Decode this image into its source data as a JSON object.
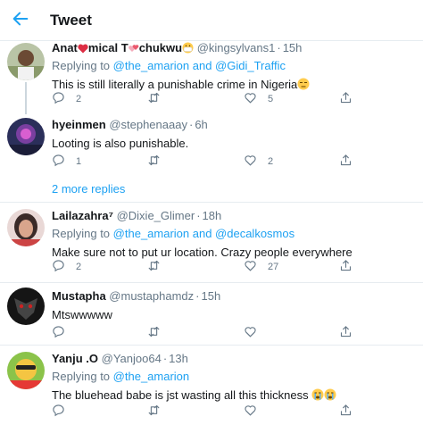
{
  "header": {
    "title": "Tweet"
  },
  "more_replies_label": "2 more replies",
  "tweets": [
    {
      "name": "Anat❤️mical T💕chukwu😷",
      "name_parts": [
        "Anat",
        "mical T",
        "chukwu"
      ],
      "handle": "@kingsylvans1",
      "time": "15h",
      "replying_label": "Replying to",
      "mentions": "@the_amarion and @Gidi_Traffic",
      "text": "This is still literally a punishable crime in Nigeria😒",
      "text_plain": "This is still literally a punishable crime in Nigeria",
      "reply_count": "2",
      "retweet_count": "",
      "like_count": "5"
    },
    {
      "name": "hyeinmen",
      "handle": "@stephenaaay",
      "time": "6h",
      "text": "Looting is also punishable.",
      "reply_count": "1",
      "retweet_count": "",
      "like_count": "2"
    },
    {
      "name": "Lailazahra⁷",
      "handle": "@Dixie_Glimer",
      "time": "18h",
      "replying_label": "Replying to",
      "mentions": "@the_amarion and @decalkosmos",
      "text": "Make sure not to put ur location. Crazy people everywhere",
      "reply_count": "2",
      "retweet_count": "",
      "like_count": "27"
    },
    {
      "name": "Mustapha",
      "handle": "@mustaphamdz",
      "time": "15h",
      "text": "Mtswwwww",
      "reply_count": "",
      "retweet_count": "",
      "like_count": ""
    },
    {
      "name": "Yanju .O",
      "handle": "@Yanjoo64",
      "time": "13h",
      "replying_label": "Replying to",
      "mentions": "@the_amarion",
      "text": "The bluehead babe is jst wasting all this thickness 😭😭",
      "text_plain": "The bluehead babe is jst wasting all this thickness",
      "reply_count": "",
      "retweet_count": "",
      "like_count": ""
    }
  ],
  "colors": {
    "accent": "#1da1f2",
    "secondary_text": "#657786",
    "divider": "#e6ecf0"
  },
  "icons": [
    "back-arrow-icon",
    "reply-icon",
    "retweet-icon",
    "like-icon",
    "share-icon"
  ]
}
